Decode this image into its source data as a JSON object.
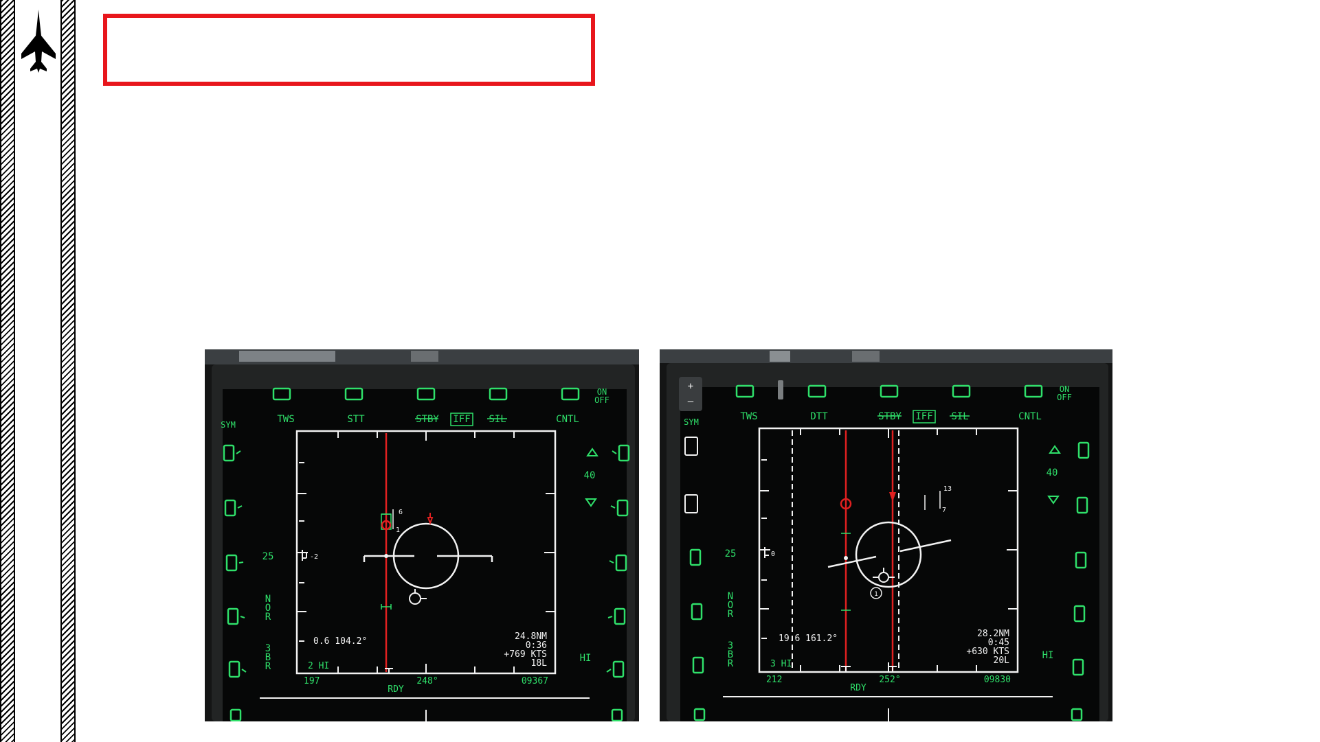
{
  "colors": {
    "phosphor": "#2fe06a",
    "display_white": "#f2f2f2",
    "cursor_red": "#e02020",
    "frame_red": "#e8161c"
  },
  "icons": {
    "logo": "fighter-jet-silhouette-icon",
    "decor": "hatched-stripe"
  },
  "title_box": {
    "text": ""
  },
  "caption": "",
  "left_display": {
    "osb_top": [
      "TWS",
      "STT",
      "STBY",
      "IFF",
      "SIL",
      "CNTL"
    ],
    "on_off": [
      "ON",
      "OFF"
    ],
    "sym_label": "SYM",
    "elevation_value": "40",
    "range_value": "25",
    "mode_letters": [
      "N",
      "O",
      "R"
    ],
    "bar_letters": [
      "3",
      "B",
      "R"
    ],
    "hi_label": "HI",
    "azimuth_info": "0.6 104.2°",
    "bar_info": "2 HI",
    "target_range": "24.8NM",
    "target_time": "0:36",
    "closure": "+769 KTS",
    "aspect": "18L",
    "altitude_left": "197",
    "ready": "RDY",
    "heading": "248°",
    "altitude_right": "09367",
    "scale_left_tag": "-2",
    "track_numbers": [
      "6",
      "1"
    ]
  },
  "right_display": {
    "osb_top": [
      "TWS",
      "DTT",
      "STBY",
      "IFF",
      "SIL",
      "CNTL"
    ],
    "on_off": [
      "ON",
      "OFF"
    ],
    "sym_label": "SYM",
    "elevation_value": "40",
    "range_value": "25",
    "mode_letters": [
      "N",
      "O",
      "R"
    ],
    "bar_letters": [
      "3",
      "B",
      "R"
    ],
    "hi_label": "HI",
    "azimuth_info": "19.6 161.2°",
    "bar_info": "3 HI",
    "target_range": "28.2NM",
    "target_time": "0:45",
    "closure": "+630 KTS",
    "aspect": "20L",
    "altitude_left": "212",
    "ready": "RDY",
    "heading": "252°",
    "altitude_right": "09830",
    "scale_left_tag": "0",
    "track_numbers": [
      "13",
      "7"
    ],
    "circle_number": "1"
  }
}
